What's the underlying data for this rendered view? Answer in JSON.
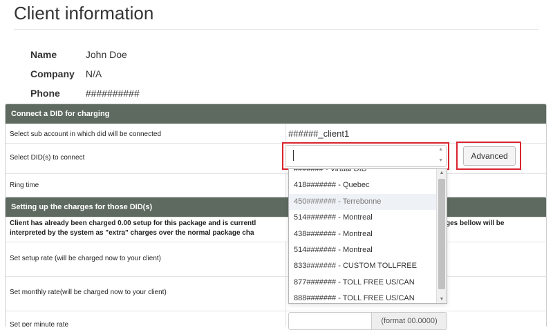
{
  "page": {
    "title": "Client information"
  },
  "client": {
    "name_label": "Name",
    "name_value": "John Doe",
    "company_label": "Company",
    "company_value": "N/A",
    "phone_label": "Phone",
    "phone_value": "##########"
  },
  "connect_panel": {
    "heading": "Connect a DID for charging",
    "sub_account_label": "Select sub account in which did will be connected",
    "sub_account_value": "######_client1",
    "select_did_label": "Select DID(s) to connect",
    "did_search_value": "",
    "advanced_button": "Advanced",
    "ring_time_label": "Ring time"
  },
  "did_dropdown": {
    "items": [
      "#######  - Virtual DID",
      "418####### - Quebec",
      "450####### - Terrebonne",
      "514####### - Montreal",
      "438####### - Montreal",
      "514####### - Montreal",
      "833####### - CUSTOM TOLLFREE",
      "877####### - TOLL FREE US/CAN",
      "888####### - TOLL FREE US/CAN"
    ],
    "hovered_item": "450####### - Terrebonne"
  },
  "charges_panel": {
    "heading": "Setting up the charges for those DID(s)",
    "notice_part1": "Client has already been charged 0.00 setup for this package and is currentl",
    "notice_part1_cont": "ges bellow will be",
    "notice_part2": "interpreted by the system as \"extra\" charges over the normal package cha",
    "setup_rate_label": "Set setup rate (will be charged now to your client)",
    "monthly_rate_label": "Set monthly rate(will be charged now to your client)",
    "per_minute_label": "Set per minute rate",
    "format_hint": "(format 00.0000)"
  },
  "colors": {
    "panel_header": "#5e6a60",
    "highlight": "#d9232e"
  }
}
